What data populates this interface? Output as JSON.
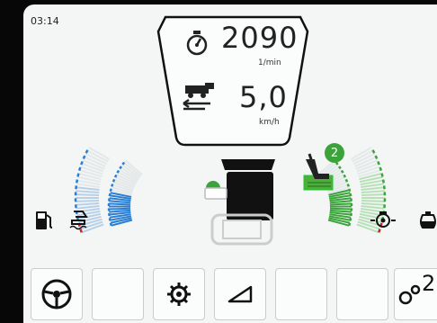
{
  "status": {
    "clock": "03:14"
  },
  "readout": {
    "engine_rpm": "2090",
    "engine_rpm_unit": "1/min",
    "ground_speed": "5,0",
    "ground_speed_unit": "km/h"
  },
  "badge": {
    "count": "2"
  },
  "gauges": {
    "left_outer_level": 0.55,
    "left_inner_level": 0.5,
    "right_outer_level": 0.7,
    "right_inner_level": 0.55
  },
  "icons": {
    "left_status": [
      "fuel-icon",
      "def-tank-icon"
    ],
    "right_status": [
      "engine-oil-icon",
      "coolant-icon"
    ],
    "softkeys": [
      "steering-wheel-icon",
      "",
      "gear-icon",
      "slope-icon",
      "",
      "gear-pair-icon"
    ]
  },
  "softkey_label": "2",
  "colors": {
    "green": "#3aa43a",
    "blue": "#2a7fd4",
    "red": "#d42020",
    "background": "#f4f6f6"
  }
}
